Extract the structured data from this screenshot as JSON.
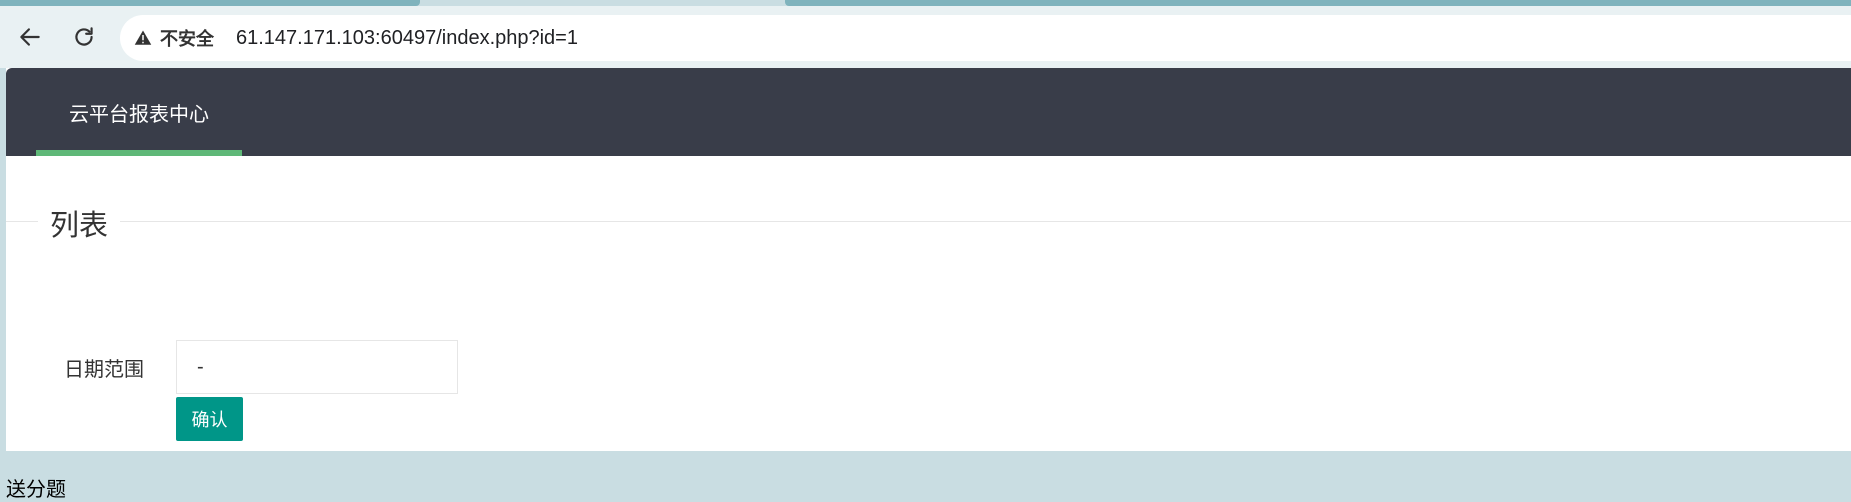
{
  "browser": {
    "security_label": "不安全",
    "url": "61.147.171.103:60497/index.php?id=1",
    "icons": {
      "back": "back-arrow-icon",
      "reload": "reload-icon",
      "warning": "warning-triangle-icon"
    }
  },
  "header": {
    "brand": "云平台报表中心",
    "accent_color": "#5fb878",
    "background_color": "#393d49"
  },
  "main": {
    "section_title": "列表",
    "form": {
      "date_range_label": "日期范围",
      "date_range_value": "-",
      "confirm_label": "确认",
      "confirm_color": "#009688"
    },
    "footer_text": "送分题"
  }
}
